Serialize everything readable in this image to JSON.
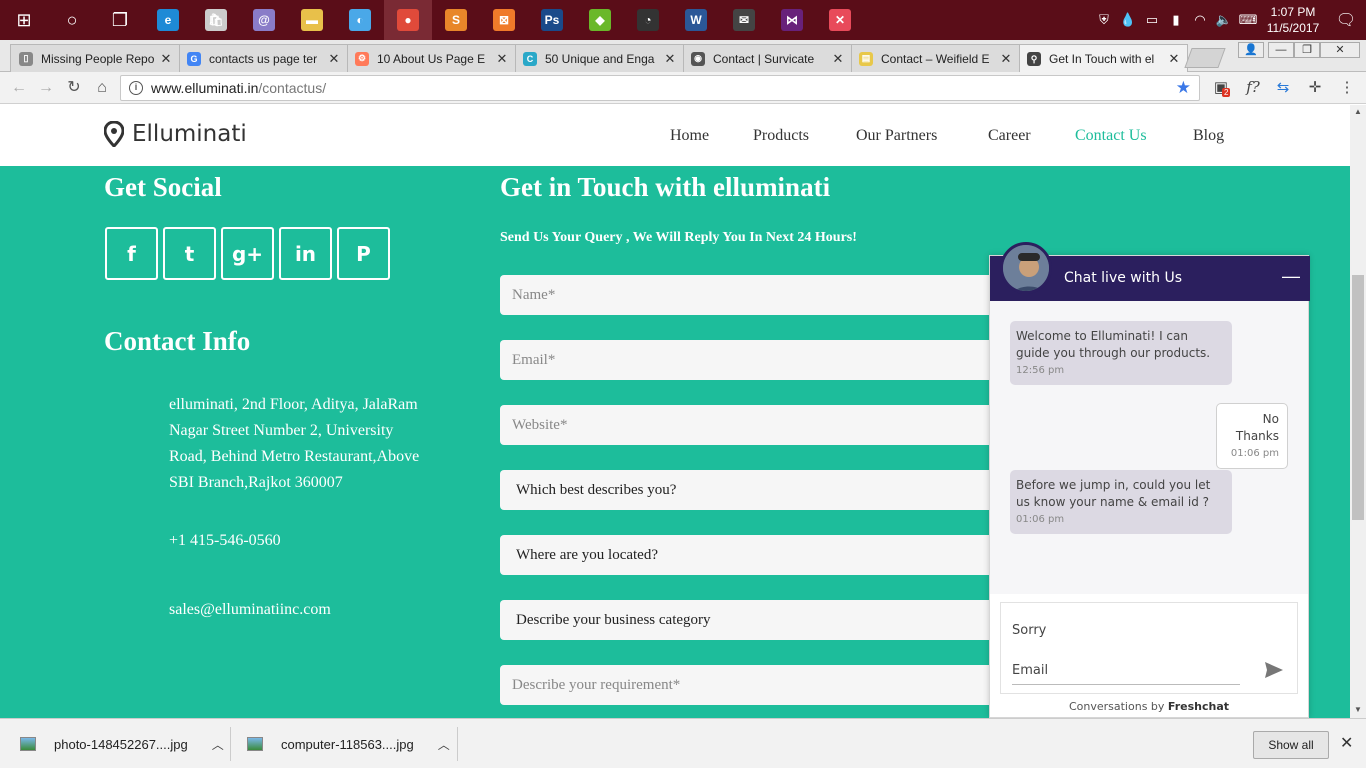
{
  "taskbar": {
    "apps": [
      {
        "name": "windows-start-icon",
        "glyph": "⊞",
        "color": "#ffffff"
      },
      {
        "name": "cortana-search-icon",
        "glyph": "○",
        "color": "#ffffff"
      },
      {
        "name": "task-view-icon",
        "glyph": "❐",
        "color": "#ffffff"
      },
      {
        "name": "edge-browser-icon",
        "glyph": "e",
        "color": "#1e8ad6"
      },
      {
        "name": "store-icon",
        "glyph": "🛍",
        "color": "#cccccc"
      },
      {
        "name": "spiral-app-icon",
        "glyph": "@",
        "color": "#8a7cc8"
      },
      {
        "name": "file-explorer-icon",
        "glyph": "▬",
        "color": "#e8c04a"
      },
      {
        "name": "photo-app-icon",
        "glyph": "◐",
        "color": "#4aa8e8"
      },
      {
        "name": "chrome-icon",
        "glyph": "●",
        "color": "#e04a3a"
      },
      {
        "name": "sublime-text-icon",
        "glyph": "S",
        "color": "#e8862a"
      },
      {
        "name": "xampp-icon",
        "glyph": "⊠",
        "color": "#f07a2a"
      },
      {
        "name": "photoshop-icon",
        "glyph": "Ps",
        "color": "#1a4a8a"
      },
      {
        "name": "gem-app-icon",
        "glyph": "◆",
        "color": "#6ab82a"
      },
      {
        "name": "speed-dial-icon",
        "glyph": "◔",
        "color": "#333333"
      },
      {
        "name": "word-icon",
        "glyph": "W",
        "color": "#2b5797"
      },
      {
        "name": "mail-icon",
        "glyph": "✉",
        "color": "#444444"
      },
      {
        "name": "visual-studio-icon",
        "glyph": "⋈",
        "color": "#68217a"
      },
      {
        "name": "xamarin-icon",
        "glyph": "✕",
        "color": "#e84a5a"
      }
    ],
    "tray_icons": [
      "shield-icon",
      "drop-icon",
      "monitor-icon",
      "battery-icon",
      "wifi-icon",
      "volume-icon",
      "keyboard-icon"
    ],
    "time": "1:07 PM",
    "date": "11/5/2017"
  },
  "tabs": [
    {
      "title": "Missing People Repo",
      "fav_color": "#888888",
      "fav_glyph": "▯"
    },
    {
      "title": "contacts us page ter",
      "fav_color": "#4285f4",
      "fav_glyph": "G"
    },
    {
      "title": "10 About Us Page E",
      "fav_color": "#ff7a59",
      "fav_glyph": "⚙"
    },
    {
      "title": "50 Unique and Enga",
      "fav_color": "#2aa8c8",
      "fav_glyph": "C"
    },
    {
      "title": "Contact | Survicate",
      "fav_color": "#555555",
      "fav_glyph": "◉"
    },
    {
      "title": "Contact – Weifield E",
      "fav_color": "#e8c84a",
      "fav_glyph": "▤"
    },
    {
      "title": "Get In Touch with el",
      "fav_color": "#444444",
      "fav_glyph": "⚲"
    }
  ],
  "address": {
    "host": "www.elluminati.in",
    "path": "/contactus/"
  },
  "extensions": {
    "badge_count": "2"
  },
  "site": {
    "logo_text": "Elluminati",
    "menu": [
      "Home",
      "Products",
      "Our Partners",
      "Career",
      "Contact Us",
      "Blog"
    ],
    "active_menu": "Contact Us",
    "accent": "#1dbd9b"
  },
  "social": {
    "title": "Get Social",
    "buttons": [
      {
        "name": "facebook-icon",
        "glyph": "f"
      },
      {
        "name": "twitter-icon",
        "glyph": "t"
      },
      {
        "name": "google-plus-icon",
        "glyph": "g+"
      },
      {
        "name": "linkedin-icon",
        "glyph": "in"
      },
      {
        "name": "pinterest-icon",
        "glyph": "P"
      }
    ]
  },
  "contact_info": {
    "title": "Contact Info",
    "address_lines": [
      "elluminati, 2nd Floor, Aditya, JalaRam",
      "Nagar Street Number 2, University",
      "Road, Behind Metro Restaurant,Above",
      "SBI Branch,Rajkot 360007"
    ],
    "phone": "+1 415-546-0560",
    "email": "sales@elluminatiinc.com"
  },
  "form": {
    "title": "Get in Touch with elluminati",
    "subtitle": "Send Us Your Query , We Will Reply You In Next 24 Hours!",
    "name_placeholder": "Name*",
    "email_placeholder": "Email*",
    "website_placeholder": "Website*",
    "select_describes": "Which best describes you?",
    "select_location": "Where are you located?",
    "select_category": "Describe your business category",
    "requirement_placeholder": "Describe your requirement*"
  },
  "chat": {
    "title": "Chat live with Us",
    "header_color": "#2b1f5e",
    "messages": [
      {
        "text": "Welcome to Elluminati! I can guide you through our products.",
        "time": "12:56 pm",
        "from": "agent"
      },
      {
        "text": "No Thanks",
        "time": "01:06 pm",
        "from": "user"
      },
      {
        "text": "Before we jump in, could you let us know your name & email id ?",
        "time": "01:06 pm",
        "from": "agent"
      }
    ],
    "input_message": "Sorry",
    "input_email_placeholder": "Email",
    "footer_prefix": "Conversations by",
    "footer_brand": "Freshchat"
  },
  "downloads": {
    "items": [
      "photo-148452267....jpg",
      "computer-118563....jpg"
    ],
    "show_all": "Show all"
  }
}
